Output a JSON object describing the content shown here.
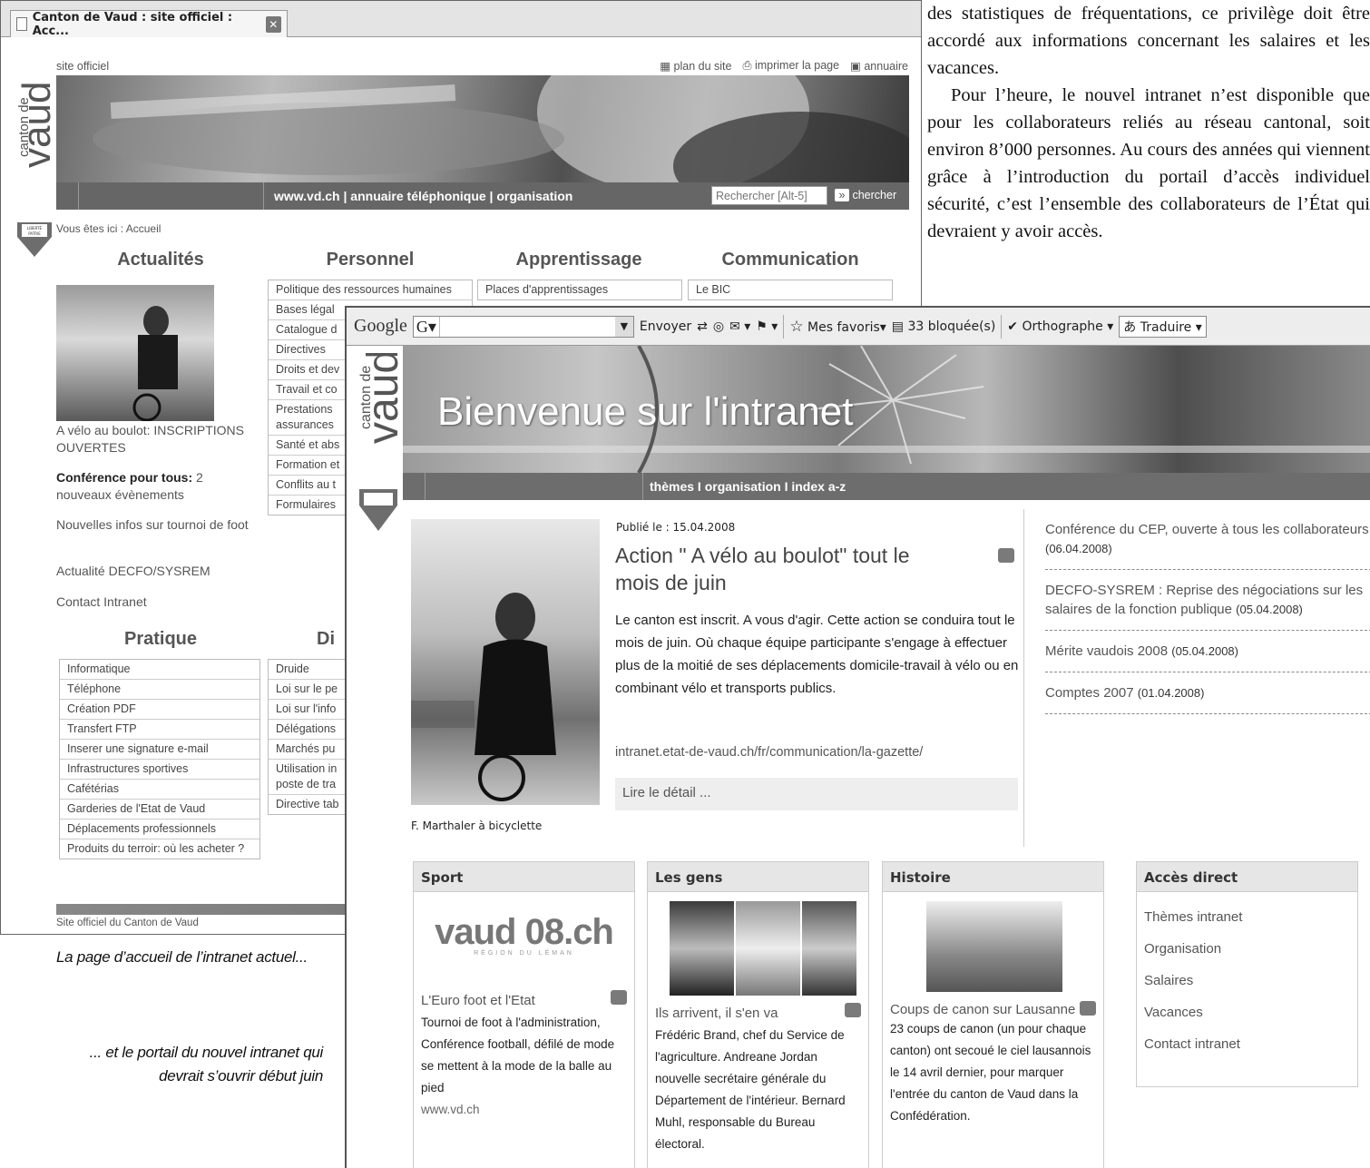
{
  "article": {
    "p1": "des statistiques de fréquentations, ce privilège doit être accordé aux informations concernant les salaires et les vacances.",
    "p2": "Pour l’heure, le nouvel intranet n’est disponible que pour les collaborateurs reliés au réseau cantonal, soit environ 8’000 personnes. Au cours des années qui viennent grâce à l’introduction du portail d’accès individuel sécurité, c’est l’ensemble des collaborateurs de l’État qui devraient y avoir accès."
  },
  "captions": {
    "old": "La page d’accueil de l’intranet actuel...",
    "new_line1": "... et le portail du nouvel intranet qui",
    "new_line2": "devrait s’ouvrir début juin"
  },
  "old": {
    "tab_title": "Canton de Vaud : site officiel : Acc...",
    "site_officiel": "site officiel",
    "top_links": [
      "plan du site",
      "imprimer la page",
      "annuaire"
    ],
    "logo_text": "canton de",
    "logo_big": "vaud",
    "logo_badge": "LIBERTÉ ET PATRIE",
    "band_links": "www.vd.ch | annuaire téléphonique | organisation",
    "search_placeholder": "Rechercher [Alt-5]",
    "search_btn": "chercher",
    "breadcrumb": "Vous êtes ici : Accueil",
    "heads": {
      "actualites": "Actualités",
      "personnel": "Personnel",
      "apprentissage": "Apprentissage",
      "communication": "Communication",
      "pratique": "Pratique",
      "di": "Di"
    },
    "actu_caption": "A vélo au boulot: INSCRIPTIONS OUVERTES",
    "actu_bold": "Conférence pour tous:",
    "actu_bold_rest": " 2 nouveaux évènements",
    "actu_items": [
      "Nouvelles infos sur tournoi de foot",
      "Actualité DECFO/SYSREM",
      "Contact Intranet"
    ],
    "personnel_items": [
      "Politique des ressources humaines",
      "Bases légal",
      "Catalogue d",
      "Directives",
      "Droits et dev",
      "Travail et co",
      "Prestations assurances",
      "Santé et abs",
      "Formation et",
      "Conflits au t",
      "Formulaires"
    ],
    "apprentissage_items": [
      "Places d'apprentissages"
    ],
    "communication_items": [
      "Le BIC"
    ],
    "pratique_items": [
      "Informatique",
      "Téléphone",
      "Création PDF",
      "Transfert FTP",
      "Inserer une signature e-mail",
      "Infrastructures sportives",
      "Cafétérias",
      "Garderies de l'Etat de Vaud",
      "Déplacements professionnels",
      "Produits du terroir: où les acheter ?"
    ],
    "di_items": [
      "Druide",
      "Loi sur le pe",
      "Loi sur l'info",
      "Délégations",
      "Marchés pu",
      "Utilisation in poste de tra",
      "Directive tab"
    ],
    "footer": "Site officiel du Canton de Vaud"
  },
  "toolbar": {
    "google": "Google",
    "envoyer": "Envoyer",
    "favoris": "Mes favoris",
    "bloquees": "33 bloquée(s)",
    "orthographe": "Orthographe",
    "traduire": "Traduire"
  },
  "new": {
    "banner_title": "Bienvenue sur l'intranet",
    "band_links": "thèmes I organisation I index a-z",
    "photo_caption": "F. Marthaler à bicyclette",
    "publie": "Publié le : 15.04.2008",
    "headline": "Action \" A vélo au boulot\" tout le mois de juin",
    "body": "Le canton est inscrit. A vous d'agir. Cette action se conduira tout le mois de juin. Où chaque équipe participante s'engage à effectuer plus de la moitié de ses déplacements domicile-travail à vélo ou en combinant vélo et transports publics.",
    "url": "intranet.etat-de-vaud.ch/fr/communication/la-gazette/",
    "lire": "Lire le détail ...",
    "news": [
      {
        "text": "Conférence du CEP, ouverte à tous les collaborateurs",
        "date": "(06.04.2008)"
      },
      {
        "text": "DECFO-SYSREM : Reprise des négociations sur les salaires de la fonction publique",
        "date": "(05.04.2008)"
      },
      {
        "text": "Mérite vaudois 2008",
        "date": "(05.04.2008)"
      },
      {
        "text": "Comptes 2007",
        "date": "(01.04.2008)"
      }
    ],
    "sport": {
      "head": "Sport",
      "logo": "vaud 08.ch",
      "logo_sub": "RÉGION DU LÉMAN",
      "title": "L'Euro foot et l'Etat",
      "body": "Tournoi de foot à l'administration, Conférence football, défilé de mode se mettent à la mode de la balle au pied",
      "link": "www.vd.ch"
    },
    "gens": {
      "head": "Les gens",
      "title": "Ils arrivent, il s'en va",
      "body": "Frédéric Brand, chef du Service de l'agriculture. Andreane Jordan nouvelle secrétaire générale du Département de l'intérieur. Bernard Muhl, responsable du Bureau électoral."
    },
    "histoire": {
      "head": "Histoire",
      "title": "Coups de canon sur Lausanne",
      "body": "23 coups de canon (un pour chaque canton) ont secoué le ciel lausannois le 14 avril dernier, pour marquer l'entrée du canton de Vaud dans la Confédération."
    },
    "acces": {
      "head": "Accès direct",
      "items": [
        "Thèmes intranet",
        "Organisation",
        "Salaires",
        "Vacances",
        "Contact intranet"
      ]
    }
  }
}
